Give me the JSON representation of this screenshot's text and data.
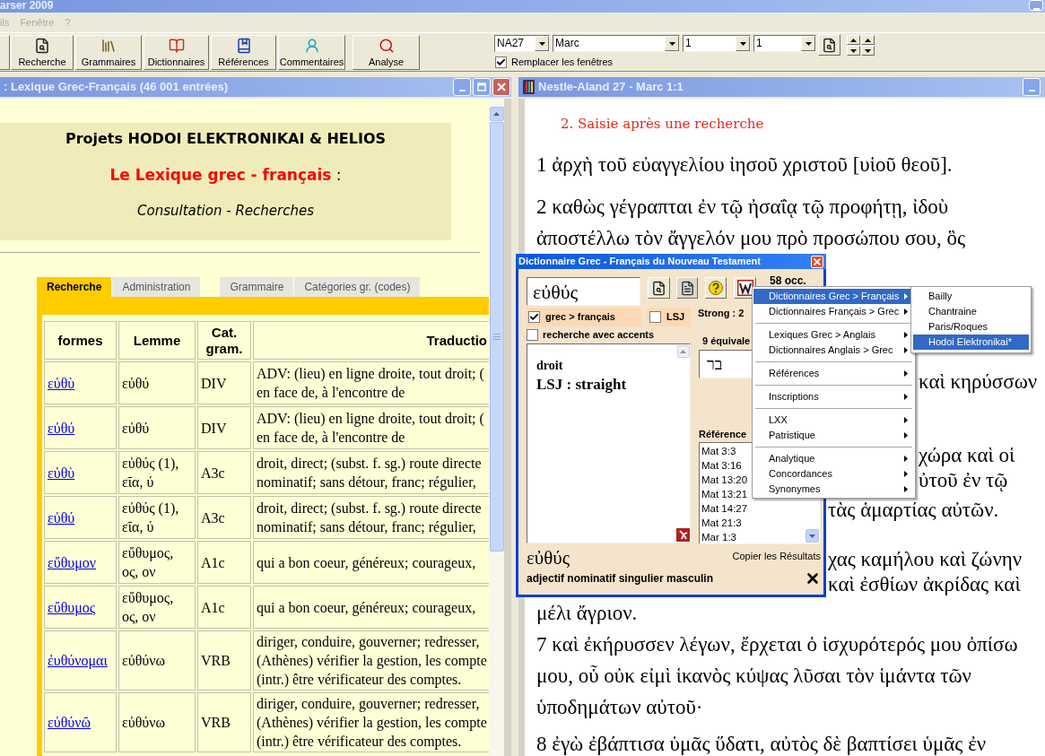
{
  "app_title_bar": {
    "title": "arser 2009"
  },
  "menu_bar": [
    {
      "label": "ils",
      "disabled": true
    },
    {
      "label": "Fenêtre",
      "disabled": true
    },
    {
      "label": "?",
      "disabled": true
    }
  ],
  "toolbar": {
    "buttons": [
      {
        "label": "Recherche"
      },
      {
        "label": "Grammaires"
      },
      {
        "label": "Dictionnaires"
      },
      {
        "label": "Références"
      },
      {
        "label": "Commentaires"
      },
      {
        "label": "Analyse"
      }
    ],
    "selectors": [
      {
        "value": "NA27"
      },
      {
        "value": "Marc"
      },
      {
        "value": "1"
      },
      {
        "value": "1"
      }
    ],
    "replace_windows": {
      "label": "Remplacer les fenêtres",
      "checked": true
    }
  },
  "lexicon_window": {
    "title": ": Lexique Grec-Français (46 001 entrées)",
    "header": {
      "project": "Projets HODOI ELEKTRONIKAI & HELIOS",
      "lexicon_title": "**Le Lexique grec - français** :",
      "subtitle": "Consultation - Recherches"
    },
    "tab_groups": [
      [
        {
          "label": "Recherche",
          "selected": true
        },
        {
          "label": "Administration",
          "selected": false
        }
      ],
      [
        {
          "label": "Grammaire",
          "selected": false
        },
        {
          "label": "Catégories gr. (codes)",
          "selected": false
        }
      ]
    ],
    "table": {
      "columns": [
        "formes",
        "Lemme",
        "Cat. gram.",
        "Traductio"
      ],
      "rows": [
        {
          "form": "εὐθὺ",
          "lemma": "εὐθύ",
          "category": "DIV",
          "translation": [
            "ADV: (lieu) en ligne droite, tout droit; (",
            "en face de, à l'encontre de"
          ]
        },
        {
          "form": "εὐθύ",
          "lemma": "εὐθύ",
          "category": "DIV",
          "translation": [
            "ADV: (lieu) en ligne droite, tout droit; (",
            "en face de, à l'encontre de"
          ]
        },
        {
          "form": "εὐθὺ",
          "lemma": "εὐθύς (1), εῖα, ύ",
          "category": "A3c",
          "translation": [
            "droit, direct; (subst. f. sg.) route directe",
            "nominatif; sans détour, franc; régulier,"
          ]
        },
        {
          "form": "εὐθύ",
          "lemma": "εὐθύς (1), εῖα, ύ",
          "category": "A3c",
          "translation": [
            "droit, direct; (subst. f. sg.) route directe",
            "nominatif; sans détour, franc; régulier,"
          ]
        },
        {
          "form": "εὔθυμον",
          "lemma": "εὔθυμος, ος, ον",
          "category": "A1c",
          "translation": [
            "qui a bon coeur, généreux; courageux,"
          ]
        },
        {
          "form": "εὔθυμος",
          "lemma": "εὔθυμος, ος, ον",
          "category": "A1c",
          "translation": [
            "qui a bon coeur, généreux; courageux,"
          ]
        },
        {
          "form": "ἐυθύνομαι",
          "lemma": "εὐθύνω",
          "category": "VRB",
          "translation": [
            "diriger, conduire, gouverner; redresser,",
            "(Athènes) vérifier la gestion, les compte",
            "(intr.) être vérificateur des comptes."
          ]
        },
        {
          "form": "εὐθύνῶ",
          "lemma": "εὐθύνω",
          "category": "VRB",
          "translation": [
            "diriger, conduire, gouverner; redresser,",
            "(Athènes) vérifier la gestion, les compte",
            "(intr.) être vérificateur des comptes."
          ]
        }
      ]
    }
  },
  "text_window": {
    "title": "Nestle-Aland 27 - Marc 1:1",
    "heading": "2. Saisie après une recherche",
    "lines": [
      {
        "text": "1 ἀρχὴ τοῦ εὐαγγελίου ἰησοῦ χριστοῦ [υἱοῦ θεοῦ].",
        "kind": "full"
      },
      {
        "text": "2 καθὼς γέγραπται ἐν τῷ ἠσαΐᾳ τῷ προφήτῃ, ἰδοὺ",
        "kind": "full"
      },
      {
        "text": "ἀποστέλλω τὸν ἄγγελόν μου πρὸ προσώπου σου, ὃς",
        "kind": "full"
      },
      {
        "text": "καὶ κηρύσσων",
        "kind": "behind_menu"
      },
      {
        "text": "χώρα καὶ οἱ",
        "kind": "behind_menu"
      },
      {
        "text": "ὐτοῦ ἐν τῷ",
        "kind": "behind_menu"
      },
      {
        "text": "τὰς ἁμαρτίας αὐτῶν.",
        "kind": "behind_dialog"
      },
      {
        "text": "χας καμήλου καὶ ζώνην",
        "kind": "behind_dialog"
      },
      {
        "text": "καὶ ἐσθίων ἀκρίδας καὶ",
        "kind": "behind_dialog"
      },
      {
        "text": "μέλι ἄγριον.",
        "kind": "full"
      },
      {
        "text": "7 καὶ ἐκήρυσσεν λέγων, ἔρχεται ὁ ἰσχυρότερός μου ὀπίσω",
        "kind": "full"
      },
      {
        "text": "μου, οὗ οὐκ εἰμὶ ἱκανὸς κύψας λῦσαι τὸν ἱμάντα τῶν",
        "kind": "full"
      },
      {
        "text": "ὑποδημάτων αὐτοῦ·",
        "kind": "full"
      },
      {
        "text": "8 ἐγὼ ἐβάπτισα ὑμᾶς ὕδατι, αὐτὸς δὲ βαπτίσει ὑμᾶς ἐν",
        "kind": "full"
      }
    ]
  },
  "dictionary_dialog": {
    "title": "Dictionnaire Grec - Français du Nouveau Testament",
    "search_value": "εὐθύς",
    "occurrences": "58 occ.",
    "option_rows": [
      [
        {
          "label": "grec > français",
          "checked": true
        },
        {
          "label": "LSJ",
          "checked": false
        }
      ],
      [
        {
          "label": "recherche avec accents",
          "checked": false
        }
      ]
    ],
    "strong": "Strong : 2",
    "definition": [
      "droit",
      "LSJ : straight"
    ],
    "equivalents_label": "9 équivale",
    "equivalent": "בר",
    "references_label": "Référence",
    "references": [
      "Mat 3:3",
      "Mat 3:16",
      "Mat 13:20",
      "Mat 13:21",
      "Mat 14:27",
      "Mat 21:3",
      "Mar 1:3"
    ],
    "copy_link": "Copier les Résultats",
    "word": "εὐθύς",
    "analysis": "adjectif nominatif singulier masculin"
  },
  "context_menu": {
    "groups": [
      [
        {
          "label": "Dictionnaires Grec > Français",
          "selected": true
        },
        {
          "label": "Dictionnaires Français > Grec",
          "selected": false
        }
      ],
      [
        {
          "label": "Lexiques Grec > Anglais",
          "selected": false
        },
        {
          "label": "Dictionnaires Anglais > Grec",
          "selected": false
        }
      ],
      [
        {
          "label": "Références",
          "selected": false
        }
      ],
      [
        {
          "label": "Inscriptions",
          "selected": false
        }
      ],
      [
        {
          "label": "LXX",
          "selected": false
        },
        {
          "label": "Patristique",
          "selected": false
        }
      ],
      [
        {
          "label": "Analytique",
          "selected": false
        },
        {
          "label": "Concordances",
          "selected": false
        },
        {
          "label": "Synonymes",
          "selected": false
        }
      ]
    ]
  },
  "submenu": {
    "items": [
      {
        "label": "Bailly",
        "selected": false
      },
      {
        "label": "Chantraine",
        "selected": false
      },
      {
        "label": "Paris/Roques",
        "selected": false
      },
      {
        "label": "Hodoi Elektronikai*",
        "selected": true
      }
    ]
  }
}
